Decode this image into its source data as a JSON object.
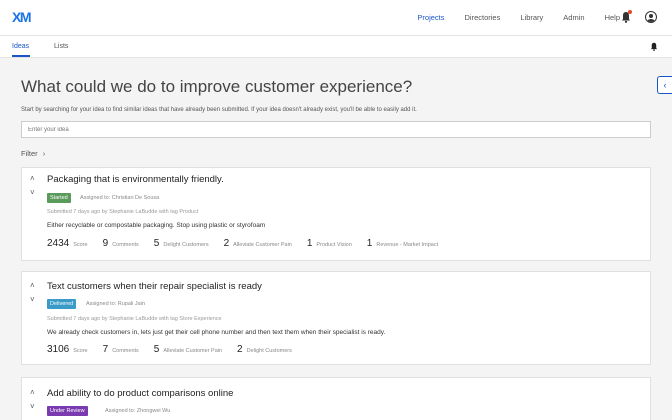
{
  "app": {
    "logo": "XM"
  },
  "topnav": [
    "Projects",
    "Directories",
    "Library",
    "Admin",
    "Help"
  ],
  "subtabs": [
    "Ideas",
    "Lists"
  ],
  "page": {
    "title": "What could we do to improve customer experience?",
    "subtitle": "Start by searching for your idea to find similar ideas that have already been submitted. If your idea doesn't already exist, you'll be able to easily add it.",
    "search_placeholder": "Enter your idea",
    "filter_label": "Filter",
    "filter_chevron": "›",
    "collapse_icon": "‹"
  },
  "icons": {
    "chevron_up": "˄",
    "chevron_down": "˅"
  },
  "colors": {
    "accent": "#1a55c8",
    "started": "#5a9a5a",
    "delivered": "#3a9ac8",
    "under_review": "#7a3ab0"
  },
  "ideas": [
    {
      "title": "Packaging that is environmentally friendly.",
      "status": "Started",
      "assigned": "Assigned to: Christian De Sousa",
      "submitted": "Submitted 7 days ago by Stephanie LaBudde with tag Product",
      "description": "Either recyclable or compostable packaging. Stop using plastic or styrofoam",
      "metrics": [
        {
          "num": "2434",
          "label": "Score"
        },
        {
          "num": "9",
          "label": "Comments"
        },
        {
          "num": "5",
          "label": "Delight Customers"
        },
        {
          "num": "2",
          "label": "Alleviate Customer Pain"
        },
        {
          "num": "1",
          "label": "Product Vision"
        },
        {
          "num": "1",
          "label": "Revenue - Market Impact"
        }
      ]
    },
    {
      "title": "Text customers when their repair specialist is ready",
      "status": "Delivered",
      "assigned": "Assigned to: Rupali Jain",
      "submitted": "Submitted 7 days ago by Stephanie LaBudde with tag Store Experience",
      "description": "We already check customers in, lets just get their cell phone number and then text them when their specialist is ready.",
      "metrics": [
        {
          "num": "3106",
          "label": "Score"
        },
        {
          "num": "7",
          "label": "Comments"
        },
        {
          "num": "5",
          "label": "Alleviate Customer Pain"
        },
        {
          "num": "2",
          "label": "Delight Customers"
        }
      ]
    },
    {
      "title": "Add ability to do product comparisons online",
      "status": "Under Review",
      "assigned": "Assigned to: Zhongwei Wu"
    }
  ]
}
